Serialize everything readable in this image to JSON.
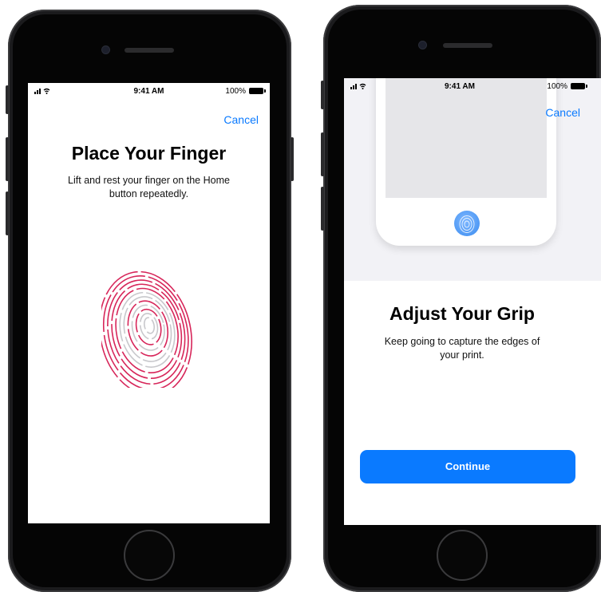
{
  "colors": {
    "accent": "#0a7aff",
    "fingerprint_progress": "#d7265a",
    "fingerprint_remaining": "#c8c8cc",
    "phone_body": "#1b1b1d"
  },
  "left_phone": {
    "status": {
      "signal_icon": "signal-wifi-icon",
      "time": "9:41 AM",
      "battery_text": "100%"
    },
    "cancel_label": "Cancel",
    "title": "Place Your Finger",
    "subtitle": "Lift and rest your finger on the Home button repeatedly.",
    "fingerprint_icon": "fingerprint-icon"
  },
  "right_phone": {
    "status": {
      "signal_icon": "signal-wifi-icon",
      "time": "9:41 AM",
      "battery_text": "100%"
    },
    "cancel_label": "Cancel",
    "title": "Adjust Your Grip",
    "subtitle": "Keep going to capture the edges of your print.",
    "continue_label": "Continue",
    "illustration_icon": "phone-home-button-icon"
  }
}
